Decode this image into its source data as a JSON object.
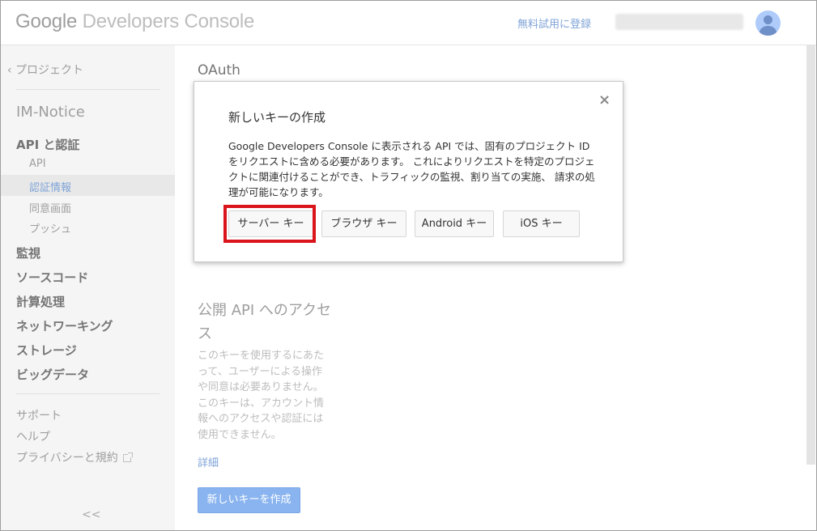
{
  "header": {
    "logo_brand": "Google",
    "logo_product": "Developers Console",
    "trial_link": "無料試用に登録"
  },
  "sidebar": {
    "back_link": "プロジェクト",
    "project_name": "IM-Notice",
    "items": [
      {
        "label": "API と認証",
        "level": "main"
      },
      {
        "label": "API",
        "level": "sub"
      },
      {
        "label": "認証情報",
        "level": "sub",
        "active": true
      },
      {
        "label": "同意画面",
        "level": "sub"
      },
      {
        "label": "プッシュ",
        "level": "sub"
      },
      {
        "label": "監視",
        "level": "main"
      },
      {
        "label": "ソースコード",
        "level": "main"
      },
      {
        "label": "計算処理",
        "level": "main"
      },
      {
        "label": "ネットワーキング",
        "level": "main"
      },
      {
        "label": "ストレージ",
        "level": "main"
      },
      {
        "label": "ビッグデータ",
        "level": "main"
      }
    ],
    "footer": [
      "サポート",
      "ヘルプ",
      "プライバシーと規約"
    ],
    "collapse_label": "<<"
  },
  "main": {
    "title": "OAuth",
    "public_api_title": "公開 API へのアクセス",
    "public_api_desc": "このキーを使用するにあたって、ユーザーによる操作や同意は必要ありません。このキーは、アカウント情報へのアクセスや認証には使用できません。",
    "details_link": "詳細",
    "create_button": "新しいキーを作成"
  },
  "dialog": {
    "title": "新しいキーの作成",
    "close_symbol": "×",
    "body": "Google Developers Console に表示される API では、固有のプロジェクト ID をリクエストに含める必要があります。 これによりリクエストを特定のプロジェクトに関連付けることができ、トラフィックの監視、割り当ての実施、 請求の処理が可能になります。",
    "buttons": [
      "サーバー キー",
      "ブラウザ キー",
      "Android キー",
      "iOS キー"
    ]
  },
  "colors": {
    "accent_link": "#7fa3d7",
    "primary_button": "#8ab4ef",
    "highlight": "#d9141b",
    "sidebar_bg": "#f5f5f5"
  }
}
